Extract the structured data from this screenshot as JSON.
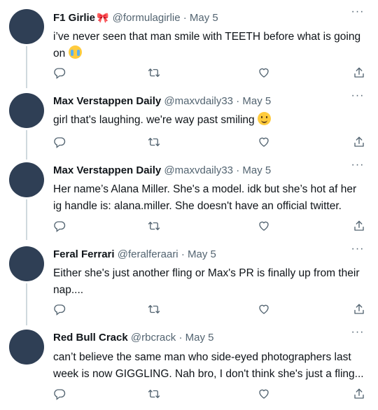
{
  "tweets": [
    {
      "name": "F1 Girlie",
      "badge_emoji": "🎀",
      "handle": "@formulagirlie",
      "separator": "·",
      "date": "May 5",
      "text": "i’ve never seen that man smile with TEETH before what is going on",
      "emoji": "loudly-crying-face"
    },
    {
      "name": "Max Verstappen Daily",
      "handle": "@maxvdaily33",
      "separator": "·",
      "date": "May 5",
      "text": "girl that's laughing. we're way past smiling",
      "emoji": "slightly-smiling-face"
    },
    {
      "name": "Max Verstappen Daily",
      "handle": "@maxvdaily33",
      "separator": "·",
      "date": "May 5",
      "text": "Her name’s Alana Miller. She's a model. idk but she’s hot af her ig handle is: alana.miller. She doesn't have an official twitter."
    },
    {
      "name": "Feral Ferrari",
      "handle": "@feralferaari",
      "separator": "·",
      "date": "May 5",
      "text": "Either she's just another fling or Max's PR is finally up from their nap...."
    },
    {
      "name": "Red Bull Crack",
      "handle": "@rbcrack",
      "separator": "·",
      "date": "May 5",
      "text": "can’t believe the same man who side-eyed photographers last week is now GIGGLING. Nah bro, I don't think she's just a fling..."
    }
  ],
  "more_glyph": "···",
  "icons": {
    "reply": "reply-icon",
    "retweet": "retweet-icon",
    "like": "like-icon",
    "share": "share-icon",
    "more": "more-icon"
  },
  "colors": {
    "text": "#0f1419",
    "secondary": "#536471",
    "avatar": "#2f3f55",
    "thread_line": "#cfd9de"
  }
}
